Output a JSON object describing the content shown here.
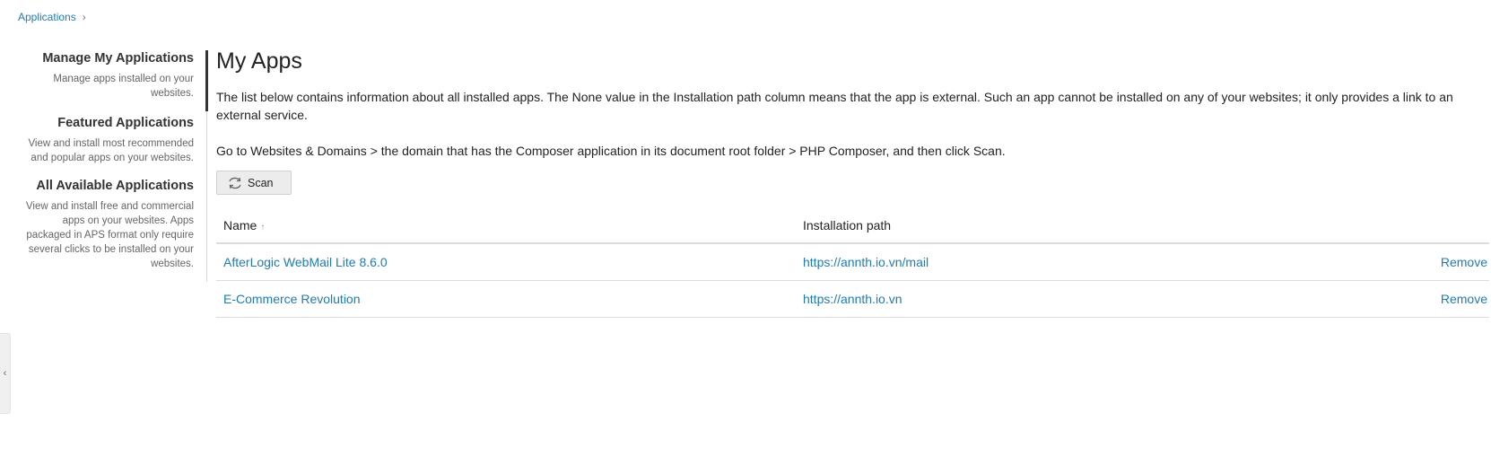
{
  "breadcrumb": {
    "items": [
      "Applications"
    ]
  },
  "sidebar": {
    "items": [
      {
        "title": "Manage My Applications",
        "desc": "Manage apps installed on your websites.",
        "active": true
      },
      {
        "title": "Featured Applications",
        "desc": "View and install most recommended and popular apps on your websites.",
        "active": false
      },
      {
        "title": "All Available Applications",
        "desc": "View and install free and commercial apps on your websites. Apps packaged in APS format only require several clicks to be installed on your websites.",
        "active": false
      }
    ]
  },
  "main": {
    "title": "My Apps",
    "description": "The list below contains information about all installed apps. The None value in the Installation path column means that the app is external. Such an app cannot be installed on any of your websites; it only provides a link to an external service.",
    "instruction": "Go to Websites & Domains > the domain that has the Composer application in its document root folder > PHP Composer, and then click Scan.",
    "scan_label": "Scan",
    "scan_icon": "scan-icon",
    "table": {
      "headers": {
        "name": "Name",
        "path": "Installation path"
      },
      "sort_icon": "sort-asc-icon",
      "rows": [
        {
          "name": "AfterLogic WebMail Lite 8.6.0",
          "path": "https://annth.io.vn/mail",
          "action": "Remove"
        },
        {
          "name": "E-Commerce Revolution",
          "path": "https://annth.io.vn",
          "action": "Remove"
        }
      ]
    }
  },
  "colors": {
    "link": "#1f7bb6",
    "text": "#222222",
    "button_bg": "#ececec",
    "border": "#dcdcdc"
  }
}
